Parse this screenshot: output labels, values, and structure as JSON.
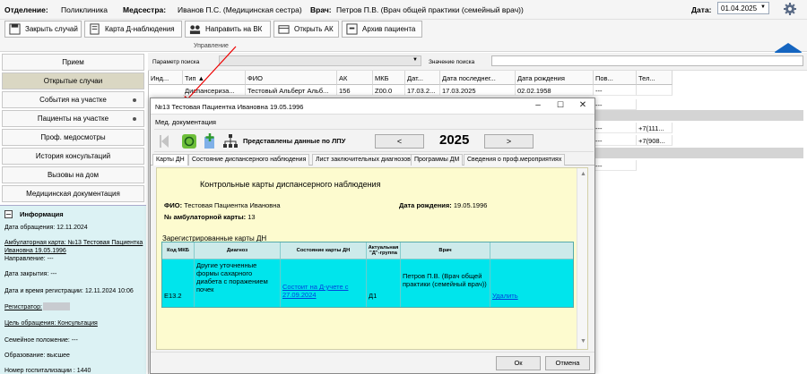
{
  "header": {
    "department_label": "Отделение:",
    "department_value": "Поликлиника",
    "nurse_label": "Медсестра:",
    "nurse_value": "Иванов П.С. (Медицинская сестра)",
    "doctor_label": "Врач:",
    "doctor_value": "Петров П.В. (Врач общей практики (семейный врач))",
    "date_label": "Дата:",
    "date_value": "01.04.2025"
  },
  "ribbon": {
    "buttons": [
      {
        "label": "Закрыть случай",
        "icon": "save-icon"
      },
      {
        "label": "Карта Д-наблюдения",
        "icon": "book-icon"
      },
      {
        "label": "Направить на ВК",
        "icon": "group-icon"
      },
      {
        "label": "Открыть АК",
        "icon": "folder-icon"
      },
      {
        "label": "Архив пациента",
        "icon": "archive-icon"
      }
    ],
    "group_caption": "Управление"
  },
  "nav": {
    "items": [
      "Прием",
      "Открытые случаи",
      "События на участке",
      "Пациенты на участке",
      "Проф. медосмотры",
      "История консультаций",
      "Вызовы на дом",
      "Медицинская документация"
    ],
    "active_index": 1
  },
  "info": {
    "title": "Информация",
    "request_date": "Дата обращения: 12.11.2024",
    "card_link": "Амбулаторная карта: №13 Тестовая Пациентка Ивановна 19.05.1996",
    "referral": "Направление: ---",
    "close_date": "Дата закрытия: ---",
    "reg_datetime": "Дата и время регистрации: 12.11.2024 10:06",
    "registrar": "Регистратор:",
    "purpose": "Цель обращения: Консультация",
    "family": "Семейное положение: ---",
    "education": "Образование: высшее",
    "hosp_number": "Номер госпитализации : 1440"
  },
  "search": {
    "param_label": "Параметр поиска",
    "value_label": "Значение поиска"
  },
  "grid": {
    "headers": [
      "Инд...",
      "Тип ▲",
      "ФИО",
      "АК",
      "МКБ",
      "Дат...",
      "Дата последнег...",
      "Дата рождения",
      "Пов...",
      "Тел..."
    ],
    "row": [
      "",
      "Диспансериза...",
      "Тестовый Альберт Альб...",
      "156",
      "Z00.0",
      "17.03.2...",
      "17.03.2025",
      "02.02.1958",
      "---",
      ""
    ],
    "extra_cells": [
      "---",
      "---",
      "+7(111...",
      "---",
      "+7(908...",
      "---"
    ]
  },
  "dialog": {
    "title": "№13 Тестовая Пациентка Ивановна 19.05.1996",
    "menu": "Мед. документация",
    "toolbar_text": "Представлены данные по ЛПУ",
    "prev": "<",
    "year": "2025",
    "next": ">",
    "tabs": [
      "Карты ДН",
      "Состояние диспансерного наблюдения",
      "Лист заключительных диагнозов",
      "Программы ДМ",
      "Сведения о проф.мероприятиях"
    ],
    "content": {
      "header": "Контрольные карты диспансерного наблюдения",
      "fio_label": "ФИО:",
      "fio_value": "Тестовая Пациентка Ивановна",
      "dob_label": "Дата рождения:",
      "dob_value": "19.05.1996",
      "amb_label": "№ амбулаторной карты:",
      "amb_value": "13",
      "registered": "Зарегистрированные карты ДН",
      "table_headers": [
        "Код МКБ",
        "Диагноз",
        "Состояние карты ДН",
        "Актуальная \"Д\"-группа",
        "Врач",
        ""
      ],
      "row": {
        "mkb": "E13.2",
        "diagnosis": "Другие уточненные формы сахарного диабета с поражением почек",
        "state": "Состоит на Д-учете с 27.09.2024",
        "group": "Д1",
        "doctor": "Петров П.В. (Врач общей практики (семейный врач))",
        "action": "Удалить"
      }
    },
    "ok": "Ок",
    "cancel": "Отмена"
  }
}
